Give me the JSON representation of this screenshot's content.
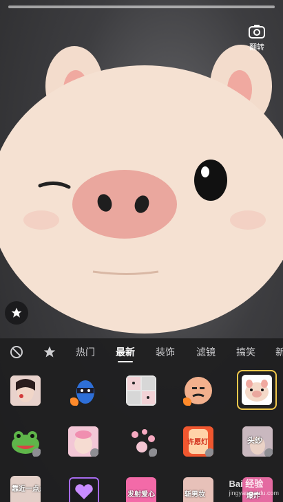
{
  "camera": {
    "flip_label": "翻转"
  },
  "tabs": [
    {
      "id": "none",
      "icon": "no-effect-icon"
    },
    {
      "id": "favorites",
      "icon": "star-icon"
    },
    {
      "id": "hot",
      "label": "热门"
    },
    {
      "id": "newest",
      "label": "最新",
      "active": true
    },
    {
      "id": "decor",
      "label": "装饰"
    },
    {
      "id": "filter",
      "label": "滤镜"
    },
    {
      "id": "funny",
      "label": "搞笑"
    },
    {
      "id": "more",
      "label": "新"
    }
  ],
  "effects_labels": {
    "hongbao": "许愿灯",
    "veil": "头纱",
    "near": "靠近一点点",
    "love": "发射爱心",
    "makeup": "斩男妆",
    "explode": "爆炸"
  },
  "colors": {
    "selected_border": "#f2c94c",
    "mic_badge": "#ff8a2a"
  },
  "watermark": {
    "brand": "Bai 经验",
    "url": "jingyan.baidu.com"
  }
}
